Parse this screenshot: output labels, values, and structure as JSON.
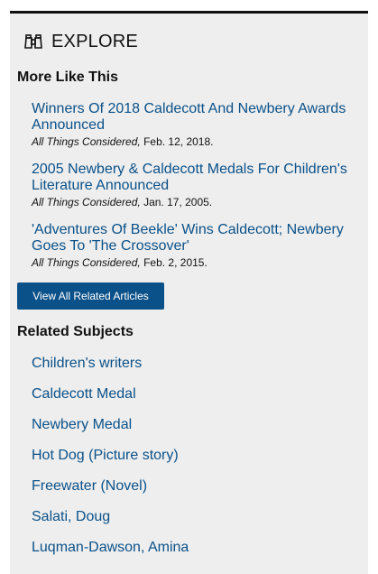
{
  "explore": {
    "icon": "binoculars-icon",
    "title": "EXPLORE"
  },
  "more_like_this": {
    "heading": "More Like This",
    "articles": [
      {
        "title": "Winners Of 2018 Caldecott And Newbery Awards Announced",
        "program": "All Things Considered,",
        "date": "Feb. 12, 2018."
      },
      {
        "title": "2005 Newbery & Caldecott Medals For Children's Literature Announced",
        "program": "All Things Considered,",
        "date": "Jan. 17, 2005."
      },
      {
        "title": "'Adventures Of Beekle' Wins Caldecott; Newbery Goes To 'The Crossover'",
        "program": "All Things Considered,",
        "date": "Feb. 2, 2015."
      }
    ],
    "view_all_label": "View All Related Articles"
  },
  "related_subjects": {
    "heading": "Related Subjects",
    "items": [
      "Children's writers",
      "Caldecott Medal",
      "Newbery Medal",
      "Hot Dog (Picture story)",
      "Freewater (Novel)",
      "Salati, Doug",
      "Luqman-Dawson, Amina"
    ]
  },
  "colors": {
    "link": "#0b5189",
    "button_bg": "#0b5189",
    "panel_bg": "#eeeeee",
    "top_border": "#111111"
  }
}
